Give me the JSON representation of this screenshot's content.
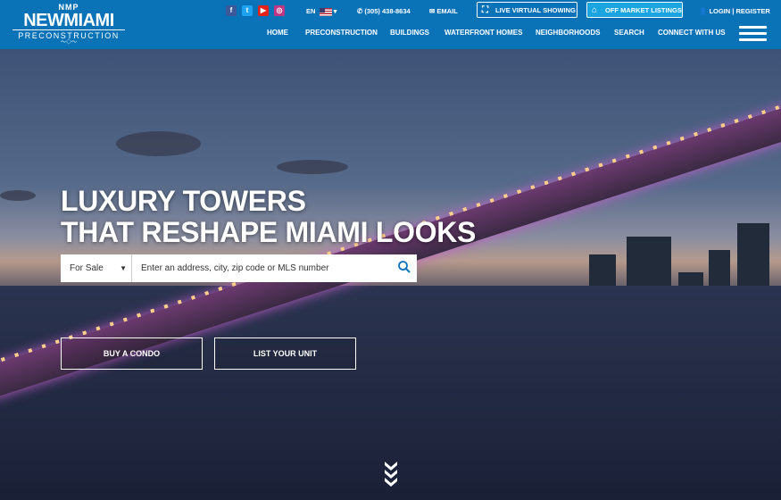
{
  "logo": {
    "small": "NMP",
    "main": "NEWMIAMI",
    "sub": "PRECONSTRUCTION"
  },
  "social": [
    "f",
    "t",
    "▶",
    "◎"
  ],
  "lang": {
    "code": "EN"
  },
  "contact": {
    "phone": "(305) 438-8634",
    "email": "EMAIL"
  },
  "buttons": {
    "live": "LIVE VIRTUAL SHOWING",
    "off": "OFF MARKET LISTINGS"
  },
  "auth": {
    "login": "LOGIN",
    "register": "REGISTER"
  },
  "nav": [
    "HOME",
    "PRECONSTRUCTION",
    "BUILDINGS",
    "WATERFRONT HOMES",
    "NEIGHBORHOODS",
    "SEARCH",
    "CONNECT WITH US"
  ],
  "hero": {
    "line1": "LUXURY TOWERS",
    "line2": "THAT RESHAPE MIAMI LOOKS"
  },
  "search": {
    "type": "For Sale",
    "placeholder": "Enter an address, city, zip code or MLS number"
  },
  "cta": {
    "buy": "BUY A CONDO",
    "list": "LIST YOUR UNIT"
  },
  "colors": {
    "header": "#0a73b8",
    "highlight": "#1aa5e0"
  }
}
